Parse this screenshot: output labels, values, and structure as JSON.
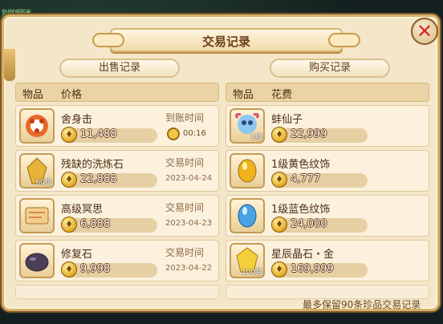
{
  "corner_text": "別的网迷",
  "title": "交易记录",
  "close_icon": "close-icon",
  "sell": {
    "header": "出售记录",
    "col_item": "物品",
    "col_price": "价格",
    "rows": [
      {
        "name": "舍身击",
        "price": "11,488",
        "meta_label": "到账时间",
        "meta_value": "00:16",
        "icon": "skill-book-icon",
        "level": ""
      },
      {
        "name": "残缺的洗炼石",
        "price": "22,888",
        "meta_label": "交易时间",
        "meta_value": "2023-04-24",
        "icon": "crystal-icon",
        "level": "60级"
      },
      {
        "name": "高级冥思",
        "price": "6,888",
        "meta_label": "交易时间",
        "meta_value": "2023-04-23",
        "icon": "scroll-icon",
        "level": ""
      },
      {
        "name": "修复石",
        "price": "9,998",
        "meta_label": "交易时间",
        "meta_value": "2023-04-22",
        "icon": "stone-icon",
        "level": ""
      }
    ]
  },
  "buy": {
    "header": "购买记录",
    "col_item": "物品",
    "col_price": "花费",
    "rows": [
      {
        "name": "蚌仙子",
        "price": "22,999",
        "icon": "pet-icon",
        "level": "1级"
      },
      {
        "name": "1级黄色纹饰",
        "price": "4,777",
        "icon": "yellow-gem-icon",
        "level": ""
      },
      {
        "name": "1级蓝色纹饰",
        "price": "24,000",
        "icon": "blue-gem-icon",
        "level": ""
      },
      {
        "name": "星辰晶石・金",
        "price": "169,999",
        "icon": "gold-crystal-icon",
        "level": "100品"
      }
    ]
  },
  "footer_note": "最多保留90条珍品交易记录",
  "colors": {
    "accent": "#d7261e",
    "panel": "#f4e6c9",
    "text": "#4b2f16"
  }
}
